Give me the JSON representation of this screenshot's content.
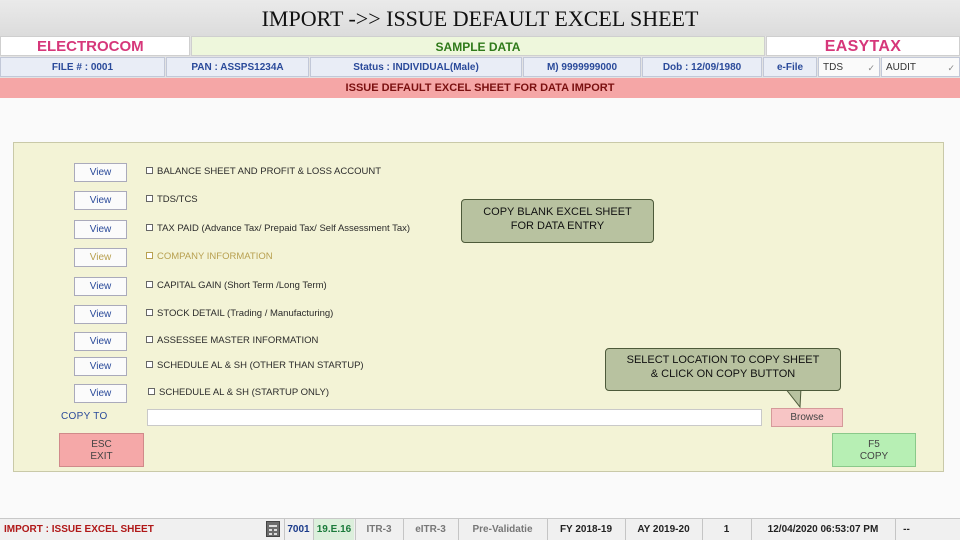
{
  "slide_title": "IMPORT ->> ISSUE DEFAULT EXCEL SHEET",
  "header": {
    "brand_left": "ELECTROCOM",
    "center": "SAMPLE DATA",
    "brand_right": "EASYTAX",
    "brand_color": "#d6377a"
  },
  "info": {
    "file": "FILE # : 0001",
    "pan": "PAN : ASSPS1234A",
    "status": "Status : INDIVIDUAL(Male)",
    "mobile": "M) 9999999000",
    "dob": "Dob : 12/09/1980",
    "efile": "e-File",
    "tds": "TDS",
    "audit": "AUDIT"
  },
  "banner": "ISSUE DEFAULT EXCEL SHEET FOR DATA IMPORT",
  "sheets": [
    {
      "view": "View",
      "label": "BALANCE SHEET AND PROFIT & LOSS ACCOUNT"
    },
    {
      "view": "View",
      "label": "TDS/TCS"
    },
    {
      "view": "View",
      "label": "TAX PAID (Advance Tax/ Prepaid Tax/ Self Assessment Tax)"
    },
    {
      "view": "View",
      "label": "COMPANY INFORMATION"
    },
    {
      "view": "View",
      "label": "CAPITAL GAIN (Short Term /Long Term)"
    },
    {
      "view": "View",
      "label": "STOCK DETAIL (Trading / Manufacturing)"
    },
    {
      "view": "View",
      "label": "ASSESSEE MASTER INFORMATION"
    },
    {
      "view": "View",
      "label": "SCHEDULE AL & SH (OTHER THAN STARTUP)"
    },
    {
      "view": "View",
      "label": "SCHEDULE AL & SH (STARTUP ONLY)"
    }
  ],
  "callouts": {
    "copy_blank_1": "COPY BLANK EXCEL SHEET",
    "copy_blank_2": "FOR DATA ENTRY",
    "select_1": "SELECT LOCATION TO COPY SHEET",
    "select_2": "& CLICK ON COPY BUTTON"
  },
  "copy_to": {
    "label": "COPY TO",
    "value": "",
    "browse": "Browse"
  },
  "actions": {
    "esc_key": "ESC",
    "esc_label": "EXIT",
    "f5_key": "F5",
    "f5_label": "COPY"
  },
  "status_bar": {
    "module": "IMPORT : ISSUE EXCEL SHEET",
    "code": "7001",
    "version": "19.E.16",
    "itr3": "ITR-3",
    "eitr3": "eITR-3",
    "preval": "Pre-Validatie",
    "fy": "FY 2018-19",
    "ay": "AY 2019-20",
    "num": "1",
    "datetime": "12/04/2020 06:53:07 PM",
    "dash": "--"
  }
}
